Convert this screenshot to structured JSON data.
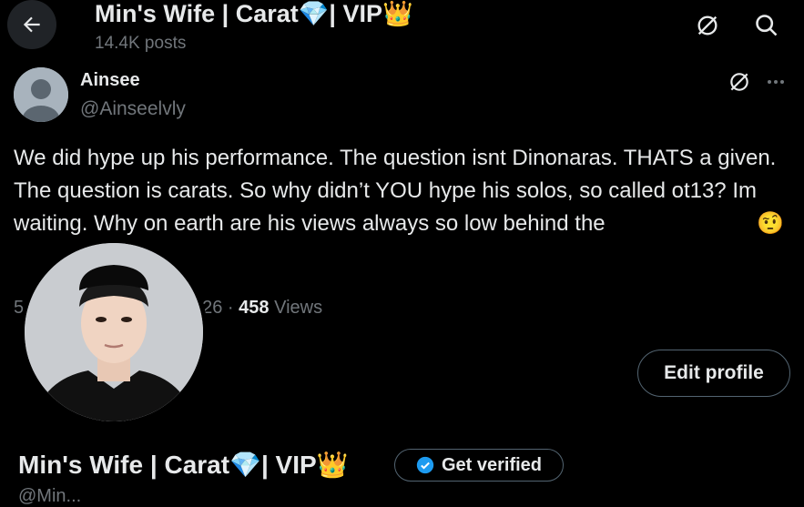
{
  "header": {
    "back_icon": "arrow-left-icon",
    "title": "Min's Wife | Carat",
    "title_gem": "💎",
    "title_suffix": "| VIP",
    "title_crown": "👑",
    "posts_count": "14.4K posts",
    "grok_icon": "grok-icon",
    "search_icon": "search-icon"
  },
  "tweet": {
    "author_name": "Ainsee",
    "author_handle": "@Ainseelvly",
    "more_icon": "more-horizontal-icon",
    "text": "We did hype up his performance. The question isnt Dinonaras. THATS a given. The question is carats. So why didn’t YOU hype his solos, so called ot13? Im waiting. Why on earth are his views always so low behind the",
    "emoji": "🤨",
    "meta_prefix": "5",
    "meta_date_tail": "26 · ",
    "views_count": "458",
    "views_label": " Views"
  },
  "profile": {
    "edit_profile_label": "Edit profile",
    "name": "Min's Wife | Carat",
    "name_gem": "💎",
    "name_suffix": "| VIP",
    "name_crown": "👑",
    "verify_icon": "verified-badge-icon",
    "get_verified_label": "Get verified",
    "handle_partial": "@Min..."
  },
  "colors": {
    "background": "#000000",
    "text_primary": "#e7e9ea",
    "text_secondary": "#71767b",
    "border": "#536471",
    "verified_blue": "#1d9bf0"
  }
}
